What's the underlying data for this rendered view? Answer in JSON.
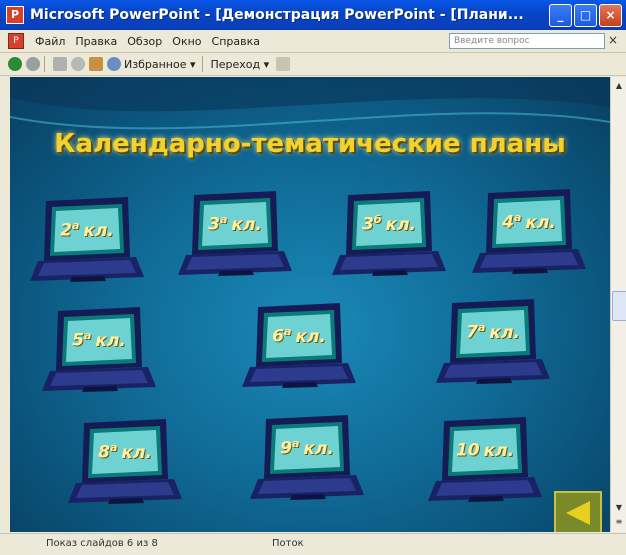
{
  "window": {
    "title": "Microsoft PowerPoint - [Демонстрация PowerPoint - [Плани...",
    "app_icon": "powerpoint-icon",
    "buttons": [
      "minimize",
      "maximize",
      "close"
    ]
  },
  "menubar": {
    "items": [
      "Файл",
      "Правка",
      "Обзор",
      "Окно",
      "Справка"
    ],
    "search_placeholder": "Введите вопрос",
    "close_label": "×"
  },
  "toolbar": {
    "items": [
      {
        "type": "icon",
        "name": "back-icon"
      },
      {
        "type": "icon",
        "name": "forward-icon"
      },
      {
        "type": "icon",
        "name": "stop-icon"
      },
      {
        "type": "icon",
        "name": "refresh-icon"
      },
      {
        "type": "icon",
        "name": "home-icon"
      },
      {
        "type": "icon",
        "name": "search-icon"
      },
      {
        "type": "text",
        "label": "Избранное ▾"
      },
      {
        "type": "text",
        "label": "Переход ▾"
      },
      {
        "type": "icon",
        "name": "window-icon"
      }
    ]
  },
  "slide": {
    "title": "Календарно-тематические планы",
    "laptops": [
      {
        "num": "2",
        "sup": "а",
        "suffix": "кл."
      },
      {
        "num": "3",
        "sup": "а",
        "suffix": "кл."
      },
      {
        "num": "3",
        "sup": "б",
        "suffix": "кл."
      },
      {
        "num": "4",
        "sup": "а",
        "suffix": "кл."
      },
      {
        "num": "5",
        "sup": "а",
        "suffix": "кл."
      },
      {
        "num": "6",
        "sup": "а",
        "suffix": "кл."
      },
      {
        "num": "7",
        "sup": "а",
        "suffix": "кл."
      },
      {
        "num": "8",
        "sup": "а",
        "suffix": "кл."
      },
      {
        "num": "9",
        "sup": "а",
        "suffix": "кл."
      },
      {
        "num": "10",
        "sup": "",
        "suffix": "кл."
      }
    ],
    "back_button_icon": "back-arrow-icon"
  },
  "statusbar": {
    "slide_info": "Показ слайдов 6 из 8",
    "mode": "Поток"
  },
  "colors": {
    "title_yellow": "#f4d22c",
    "slide_bg": "#106a96",
    "laptop_body": "#1a2266",
    "screen_glow": "#7fe2e0"
  }
}
